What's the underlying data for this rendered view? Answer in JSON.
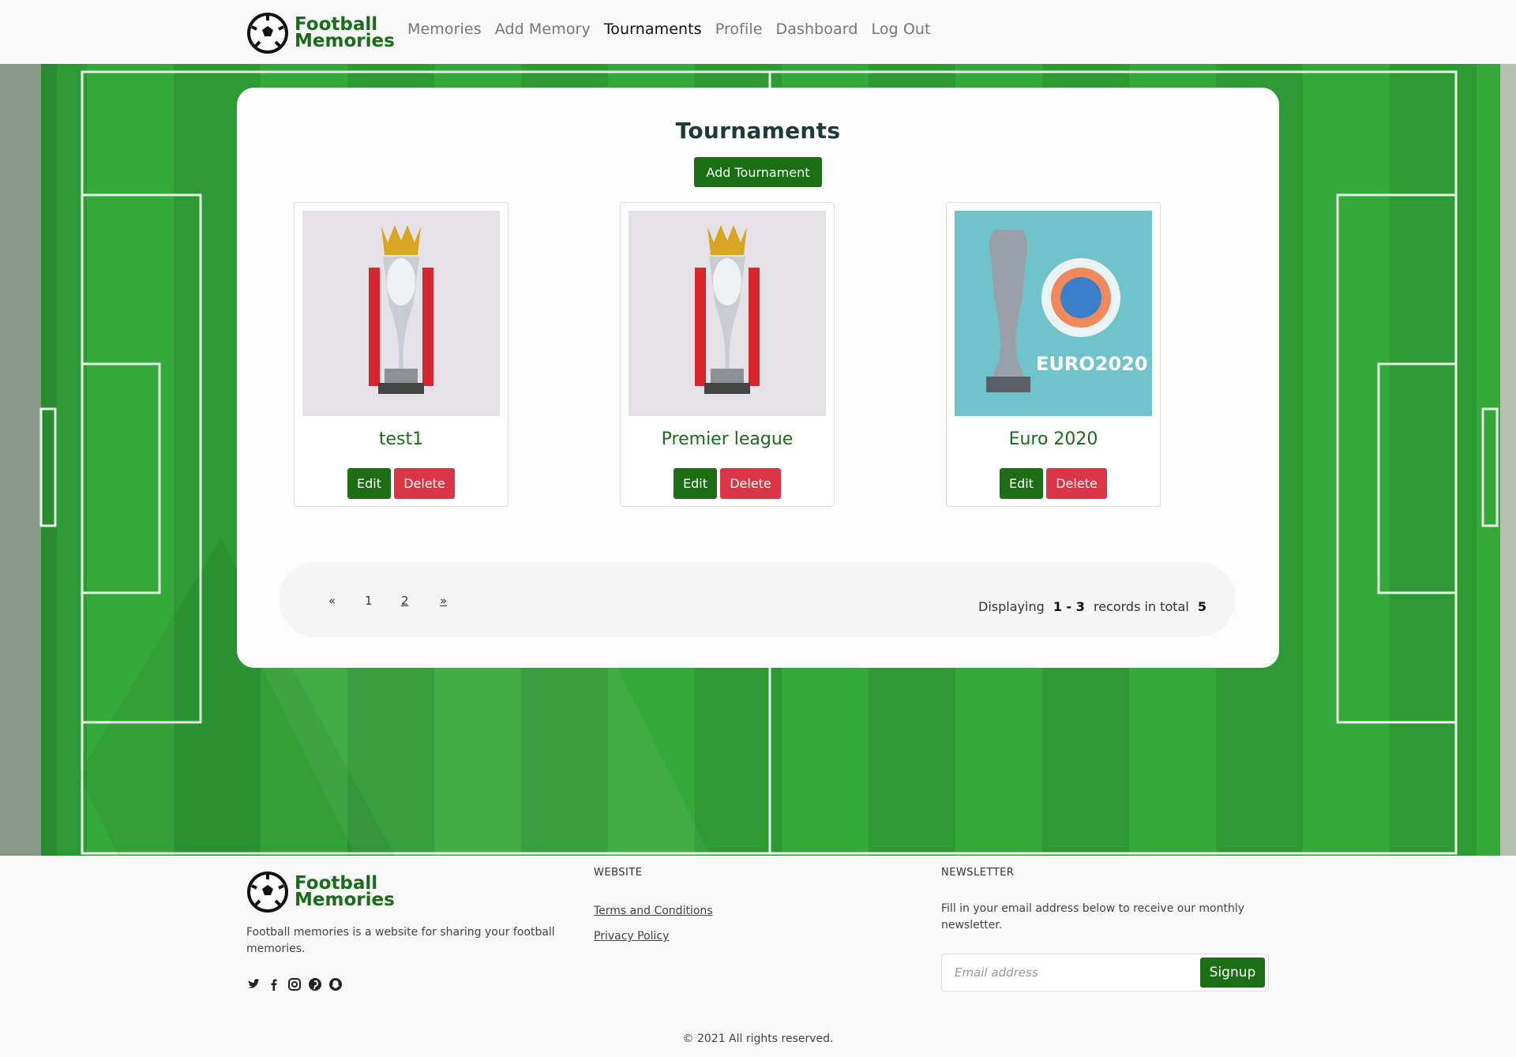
{
  "brand": {
    "line1": "Football",
    "line2": "Memories"
  },
  "nav": [
    {
      "label": "Memories",
      "active": false
    },
    {
      "label": "Add Memory",
      "active": false
    },
    {
      "label": "Tournaments",
      "active": true
    },
    {
      "label": "Profile",
      "active": false
    },
    {
      "label": "Dashboard",
      "active": false
    },
    {
      "label": "Log Out",
      "active": false
    }
  ],
  "main": {
    "title": "Tournaments",
    "add_label": "Add Tournament",
    "tournaments": [
      {
        "name": "test1",
        "image": "premier-league-trophy",
        "edit": "Edit",
        "delete": "Delete"
      },
      {
        "name": "Premier league",
        "image": "premier-league-trophy",
        "edit": "Edit",
        "delete": "Delete"
      },
      {
        "name": "Euro 2020",
        "image": "euro-2020-trophy",
        "edit": "Edit",
        "delete": "Delete",
        "image_text": "EURO2020"
      }
    ],
    "pagination": {
      "prev": "«",
      "pages": [
        "1",
        "2"
      ],
      "next": "»",
      "summary_prefix": "Displaying",
      "range": "1 - 3",
      "summary_mid": "records in total",
      "total": "5"
    }
  },
  "footer": {
    "description": "Football memories is a website for sharing your football memories.",
    "social_icons": [
      "twitter-icon",
      "facebook-icon",
      "instagram-icon",
      "pinterest-icon",
      "snapchat-icon"
    ],
    "website_heading": "WEBSITE",
    "links": [
      "Terms and Conditions",
      "Privacy Policy"
    ],
    "newsletter_heading": "NEWSLETTER",
    "newsletter_text": "Fill in your email address below to receive our monthly newsletter.",
    "email_placeholder": "Email address",
    "signup_label": "Signup",
    "copyright": "© 2021 All rights reserved."
  },
  "colors": {
    "brand_green": "#1c6e14",
    "delete_red": "#dc3545",
    "pitch_green": "#2e9a34"
  }
}
